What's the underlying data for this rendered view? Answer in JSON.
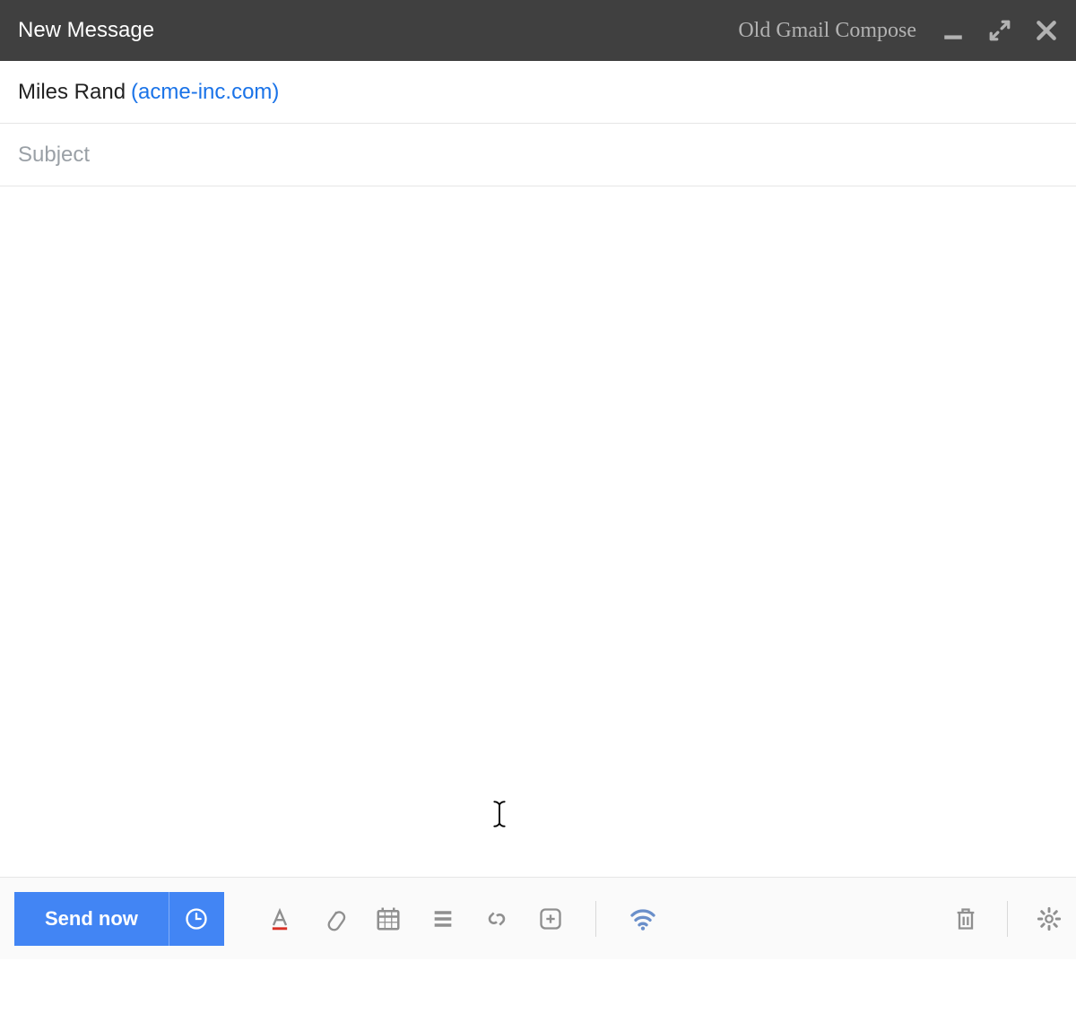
{
  "header": {
    "title": "New Message",
    "link_label": "Old Gmail Compose"
  },
  "recipient": {
    "name": "Miles Rand",
    "domain": "(acme-inc.com)"
  },
  "subject": {
    "placeholder": "Subject",
    "value": ""
  },
  "toolbar": {
    "send_label": "Send now"
  }
}
